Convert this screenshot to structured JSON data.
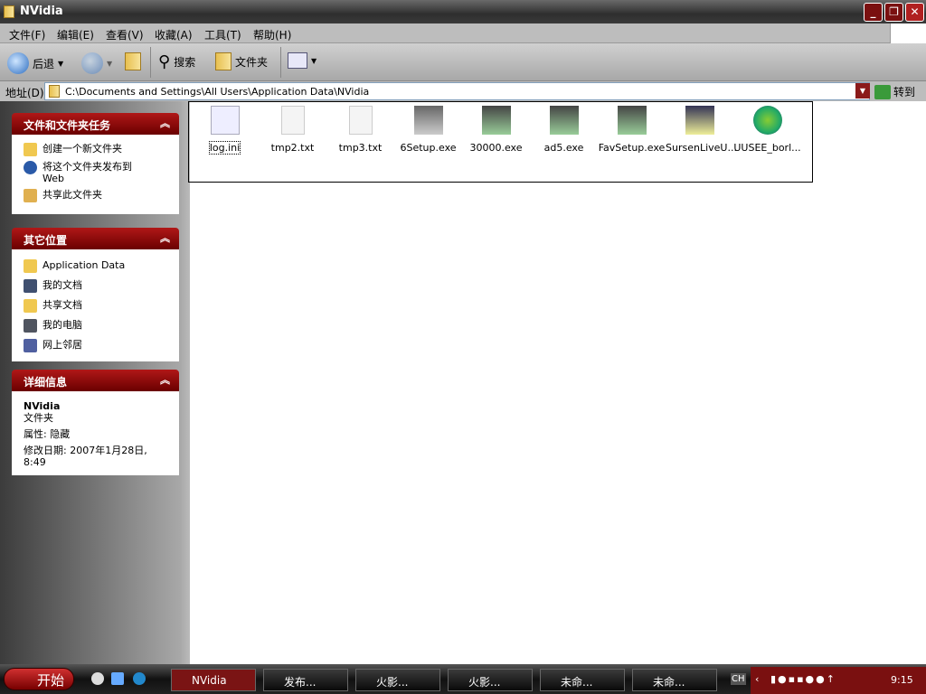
{
  "window": {
    "title": "NVidia"
  },
  "menu": [
    "文件(F)",
    "编辑(E)",
    "查看(V)",
    "收藏(A)",
    "工具(T)",
    "帮助(H)"
  ],
  "toolbar": {
    "back": "后退",
    "search": "搜索",
    "folders": "文件夹"
  },
  "address": {
    "label": "地址(D)",
    "value": "C:\\Documents and Settings\\All Users\\Application Data\\NVidia",
    "go": "转到"
  },
  "panels": {
    "tasks": {
      "title": "文件和文件夹任务",
      "items": [
        "创建一个新文件夹",
        "将这个文件夹发布到 Web",
        "共享此文件夹"
      ]
    },
    "places": {
      "title": "其它位置",
      "items": [
        "Application Data",
        "我的文档",
        "共享文档",
        "我的电脑",
        "网上邻居"
      ]
    },
    "details": {
      "title": "详细信息",
      "name": "NVidia",
      "type": "文件夹",
      "attr": "属性: 隐藏",
      "modified": "修改日期: 2007年1月28日, 8:49"
    }
  },
  "files": [
    "log.ini",
    "tmp2.txt",
    "tmp3.txt",
    "6Setup.exe",
    "30000.exe",
    "ad5.exe",
    "FavSetup.exe",
    "SursenLiveU...",
    "UUSEE_borl..."
  ],
  "taskbar": {
    "start": "开始",
    "buttons": [
      "NVidia",
      "发布...",
      "火影...",
      "火影...",
      "未命...",
      "未命..."
    ],
    "lang": "CH",
    "clock": "9:15"
  }
}
